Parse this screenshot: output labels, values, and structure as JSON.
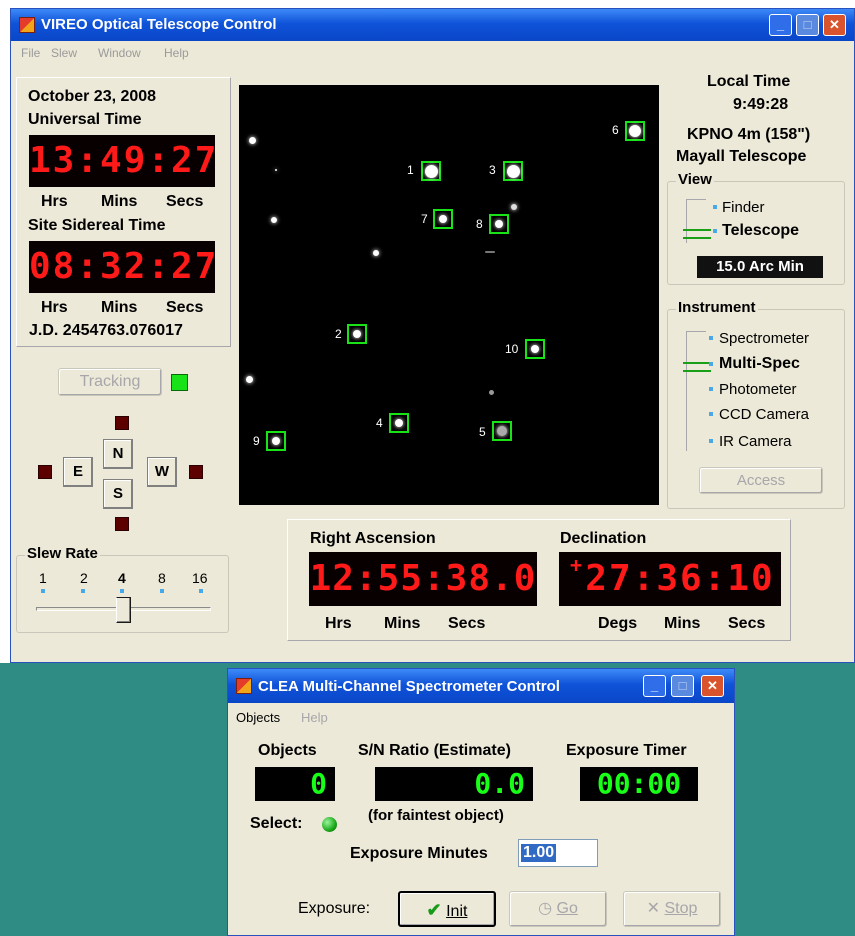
{
  "main_window": {
    "title": "VIREO Optical Telescope Control",
    "menu": [
      "File",
      "Slew",
      "Window",
      "Help"
    ],
    "date": "October 23, 2008",
    "universal_time_label": "Universal Time",
    "universal_time": "13:49:27",
    "hms_labels": [
      "Hrs",
      "Mins",
      "Secs"
    ],
    "sidereal_label": "Site Sidereal Time",
    "sidereal_time": "08:32:27",
    "jd": "J.D. 2454763.076017",
    "tracking_label": "Tracking",
    "directions": {
      "n": "N",
      "s": "S",
      "e": "E",
      "w": "W"
    },
    "slew_rate": {
      "title": "Slew Rate",
      "options": [
        "1",
        "2",
        "4",
        "8",
        "16"
      ],
      "selected": "4"
    },
    "local_time_label": "Local Time",
    "local_time": "9:49:28",
    "telescope_name": "KPNO 4m (158\")",
    "telescope_sub": "Mayall Telescope",
    "view": {
      "title": "View",
      "options": [
        "Finder",
        "Telescope"
      ],
      "selected": "Telescope",
      "field": "15.0 Arc Min"
    },
    "instrument": {
      "title": "Instrument",
      "options": [
        "Spectrometer",
        "Multi-Spec",
        "Photometer",
        "CCD Camera",
        "IR Camera"
      ],
      "selected": "Multi-Spec",
      "access_label": "Access"
    },
    "ra": {
      "title": "Right Ascension",
      "value": "12:55:38.0",
      "labels": [
        "Hrs",
        "Mins",
        "Secs"
      ]
    },
    "dec": {
      "title": "Declination",
      "sign": "+",
      "value": "27:36:10",
      "labels": [
        "Degs",
        "Mins",
        "Secs"
      ]
    },
    "objects": [
      "1",
      "2",
      "3",
      "4",
      "5",
      "6",
      "7",
      "8",
      "9",
      "10"
    ]
  },
  "spec_window": {
    "title": "CLEA Multi-Channel Spectrometer Control",
    "menu": [
      "Objects",
      "Help"
    ],
    "objects_label": "Objects",
    "objects_value": "0",
    "sn_label": "S/N Ratio (Estimate)",
    "sn_value": "0.0",
    "sn_note": "(for faintest object)",
    "timer_label": "Exposure Timer",
    "timer_value": "00:00",
    "select_label": "Select:",
    "exposure_minutes_label": "Exposure Minutes",
    "exposure_minutes_value": "1.00",
    "exposure_label": "Exposure:",
    "init_label": "Init",
    "go_label": "Go",
    "stop_label": "Stop"
  }
}
